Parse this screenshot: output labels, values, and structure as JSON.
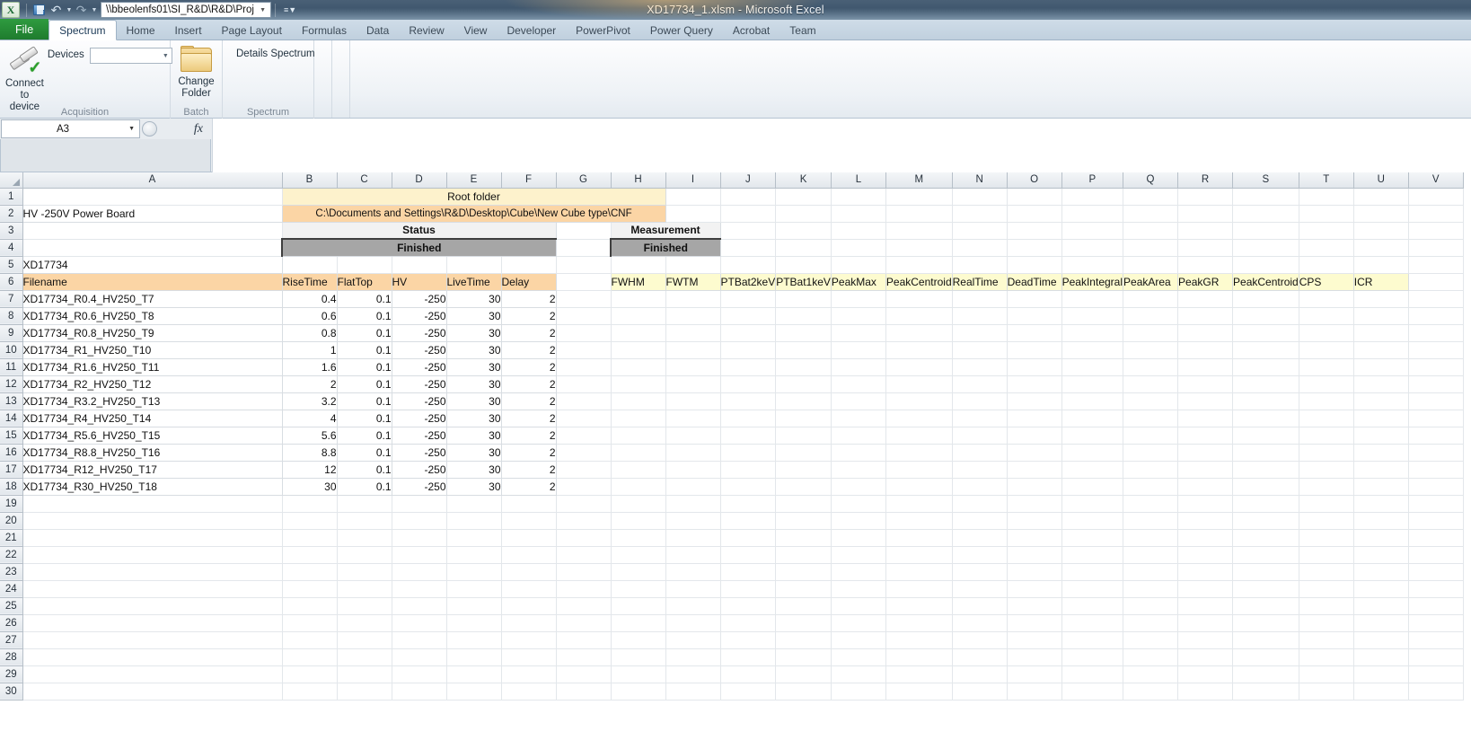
{
  "window": {
    "title": "XD17734_1.xlsm  -  Microsoft Excel",
    "excel_icon": "excel-icon",
    "qat": {
      "save": "save-icon",
      "undo": "↰",
      "redo": "↱",
      "address_value": "\\\\bbeolenfs01\\SI_R&D\\R&D\\Proj",
      "more": "customize-quick-access-toolbar"
    }
  },
  "ribbon": {
    "tabs": [
      {
        "label": "File",
        "type": "file"
      },
      {
        "label": "Spectrum",
        "type": "active"
      },
      {
        "label": "Home",
        "type": "normal"
      },
      {
        "label": "Insert",
        "type": "normal"
      },
      {
        "label": "Page Layout",
        "type": "normal"
      },
      {
        "label": "Formulas",
        "type": "normal"
      },
      {
        "label": "Data",
        "type": "normal"
      },
      {
        "label": "Review",
        "type": "normal"
      },
      {
        "label": "View",
        "type": "normal"
      },
      {
        "label": "Developer",
        "type": "normal"
      },
      {
        "label": "PowerPivot",
        "type": "normal"
      },
      {
        "label": "Power Query",
        "type": "normal"
      },
      {
        "label": "Acrobat",
        "type": "normal"
      },
      {
        "label": "Team",
        "type": "normal"
      }
    ],
    "groups": {
      "acquisition": {
        "name": "Acquisition",
        "connect_line1": "Connect",
        "connect_line2": "to device",
        "devices_label": "Devices",
        "devices_value": ""
      },
      "batch": {
        "name": "Batch",
        "change_folder_line1": "Change",
        "change_folder_line2": "Folder"
      },
      "spectrum": {
        "name": "Spectrum",
        "details_spectrum": "Details Spectrum"
      }
    }
  },
  "formula_bar": {
    "name_box": "A3",
    "formula_value": "",
    "fx_label": "fx"
  },
  "sheet": {
    "column_headers": [
      "A",
      "B",
      "C",
      "D",
      "E",
      "F",
      "G",
      "H",
      "I",
      "J",
      "K",
      "L",
      "M",
      "N",
      "O",
      "P",
      "Q",
      "R",
      "S",
      "T",
      "U",
      "V"
    ],
    "row_numbers": [
      1,
      2,
      3,
      4,
      5,
      6,
      7,
      8,
      9,
      10,
      11,
      12,
      13,
      14,
      15,
      16,
      17,
      18,
      19,
      20,
      21,
      22,
      23,
      24,
      25,
      26,
      27,
      28,
      29,
      30
    ],
    "banners": {
      "root_folder_label": "Root folder",
      "root_folder_path": "C:\\Documents and Settings\\R&D\\Desktop\\Cube\\New Cube type\\CNF",
      "device_name": "HV -250V Power Board",
      "status_label": "Status",
      "measurement_label": "Measurement",
      "status_value": "Finished",
      "measurement_value": "Finished",
      "sample_id": "XD17734"
    },
    "headers_left": [
      "Filename",
      "RiseTime",
      "FlatTop",
      "HV",
      "LiveTime",
      "Delay"
    ],
    "headers_right": [
      "FWHM",
      "FWTM",
      "PTBat2keV",
      "PTBat1keV",
      "PeakMax",
      "PeakCentroid",
      "RealTime",
      "DeadTime",
      "PeakIntegral",
      "PeakArea",
      "PeakGR",
      "PeakCentroid",
      "CPS",
      "ICR"
    ],
    "rows": [
      {
        "row": 7,
        "filename": "XD17734_R0.4_HV250_T7",
        "risetime": "0.4",
        "flattop": "0.1",
        "hv": "-250",
        "livetime": "30",
        "delay": "2"
      },
      {
        "row": 8,
        "filename": "XD17734_R0.6_HV250_T8",
        "risetime": "0.6",
        "flattop": "0.1",
        "hv": "-250",
        "livetime": "30",
        "delay": "2"
      },
      {
        "row": 9,
        "filename": "XD17734_R0.8_HV250_T9",
        "risetime": "0.8",
        "flattop": "0.1",
        "hv": "-250",
        "livetime": "30",
        "delay": "2"
      },
      {
        "row": 10,
        "filename": "XD17734_R1_HV250_T10",
        "risetime": "1",
        "flattop": "0.1",
        "hv": "-250",
        "livetime": "30",
        "delay": "2"
      },
      {
        "row": 11,
        "filename": "XD17734_R1.6_HV250_T11",
        "risetime": "1.6",
        "flattop": "0.1",
        "hv": "-250",
        "livetime": "30",
        "delay": "2"
      },
      {
        "row": 12,
        "filename": "XD17734_R2_HV250_T12",
        "risetime": "2",
        "flattop": "0.1",
        "hv": "-250",
        "livetime": "30",
        "delay": "2"
      },
      {
        "row": 13,
        "filename": "XD17734_R3.2_HV250_T13",
        "risetime": "3.2",
        "flattop": "0.1",
        "hv": "-250",
        "livetime": "30",
        "delay": "2"
      },
      {
        "row": 14,
        "filename": "XD17734_R4_HV250_T14",
        "risetime": "4",
        "flattop": "0.1",
        "hv": "-250",
        "livetime": "30",
        "delay": "2"
      },
      {
        "row": 15,
        "filename": "XD17734_R5.6_HV250_T15",
        "risetime": "5.6",
        "flattop": "0.1",
        "hv": "-250",
        "livetime": "30",
        "delay": "2"
      },
      {
        "row": 16,
        "filename": "XD17734_R8.8_HV250_T16",
        "risetime": "8.8",
        "flattop": "0.1",
        "hv": "-250",
        "livetime": "30",
        "delay": "2"
      },
      {
        "row": 17,
        "filename": "XD17734_R12_HV250_T17",
        "risetime": "12",
        "flattop": "0.1",
        "hv": "-250",
        "livetime": "30",
        "delay": "2"
      },
      {
        "row": 18,
        "filename": "XD17734_R30_HV250_T18",
        "risetime": "30",
        "flattop": "0.1",
        "hv": "-250",
        "livetime": "30",
        "delay": "2"
      }
    ],
    "empty_rows": [
      19,
      20,
      21,
      22,
      23,
      24,
      25,
      26,
      27,
      28,
      29,
      30
    ]
  },
  "colors": {
    "accent_orange": "#fbd5a5",
    "accent_yellow": "#fdfbcf",
    "light_yellow": "#fdf2cc",
    "status_gray": "#a6a6a6",
    "file_tab_green": "#2e9b3f"
  }
}
